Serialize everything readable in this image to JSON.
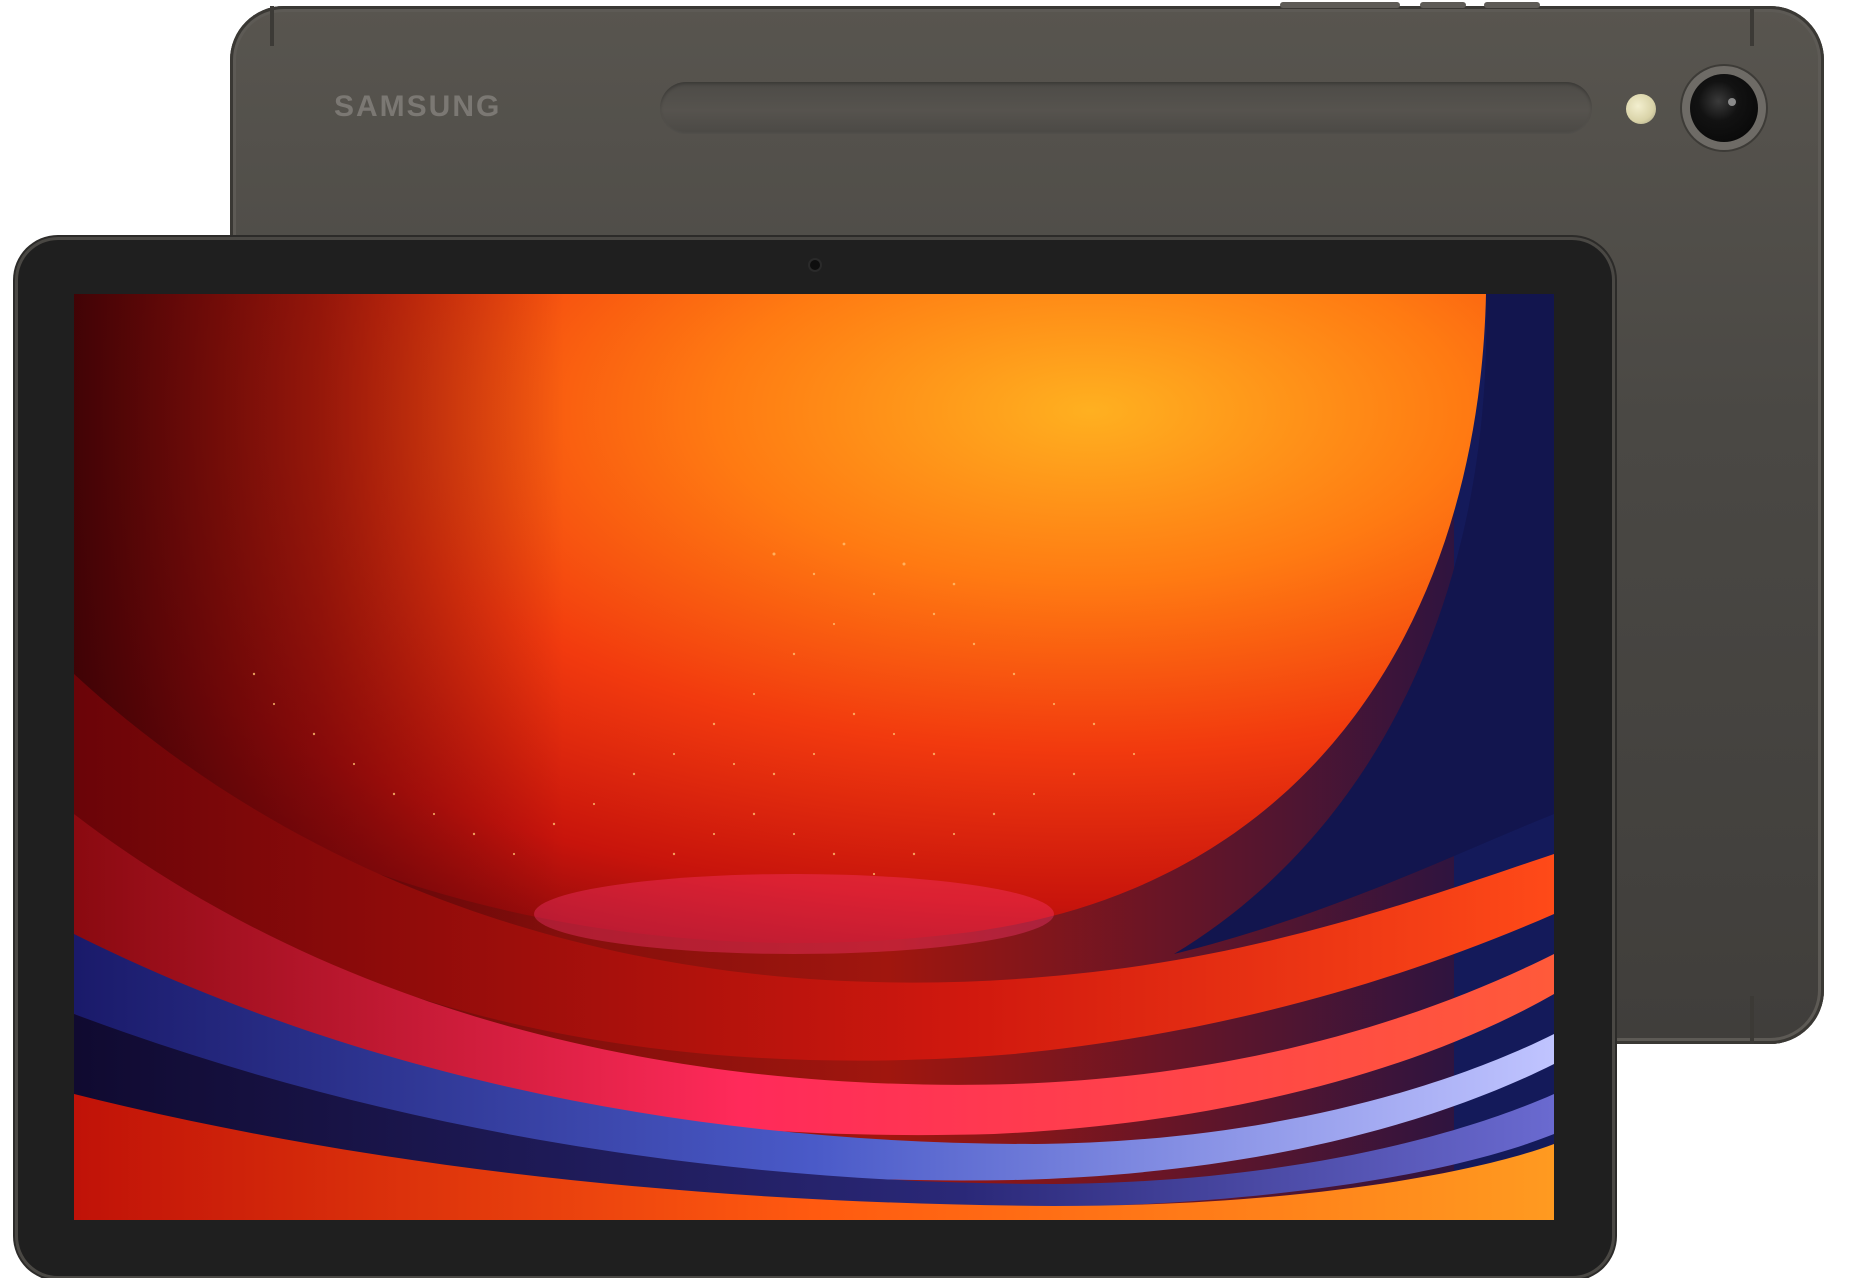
{
  "product": {
    "brand_logo_text": "SAMSUNG"
  },
  "colors": {
    "body": "#4a4844",
    "bezel": "#1f1f1f",
    "wallpaper_deep_red": "#7a0a0c",
    "wallpaper_orange": "#ff6a10",
    "wallpaper_navy": "#141a5a"
  },
  "icons": {
    "rear_camera": "camera-lens-icon",
    "flash": "flash-led-icon",
    "front_camera": "front-camera-icon"
  }
}
